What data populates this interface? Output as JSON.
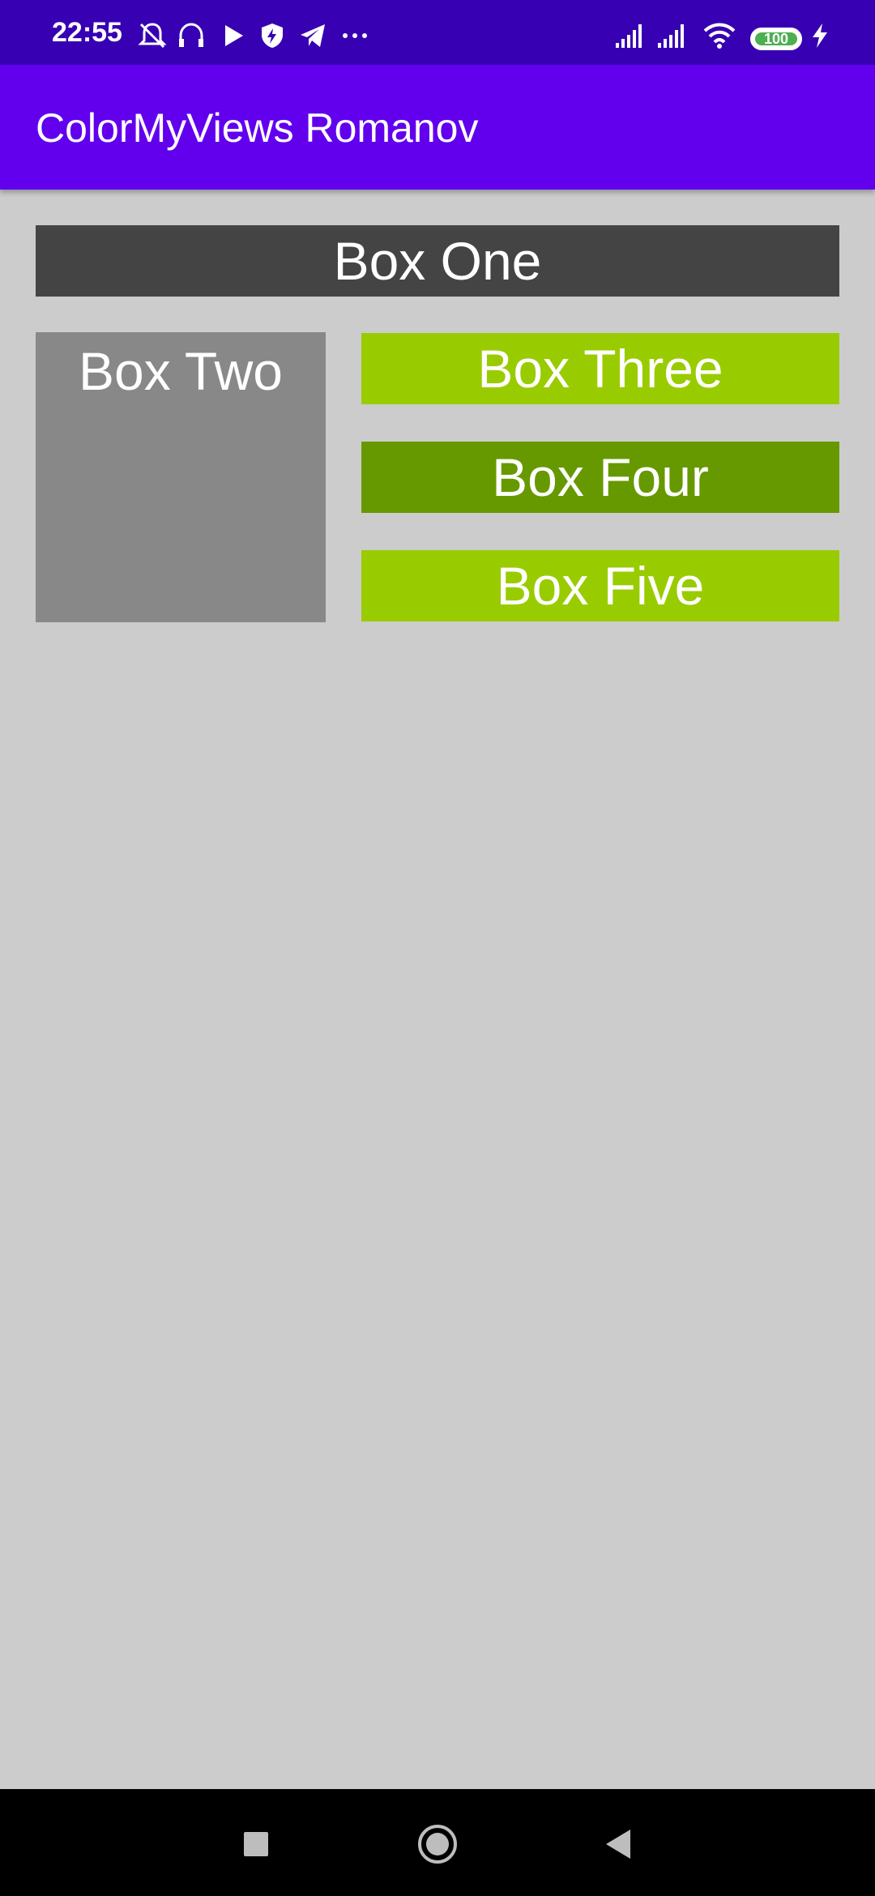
{
  "status_bar": {
    "time": "22:55",
    "battery_level": "100",
    "icons": [
      "bell-off-icon",
      "headphones-icon",
      "play-icon",
      "shield-icon",
      "telegram-icon",
      "more-icon",
      "signal-icon",
      "signal-icon",
      "wifi-icon",
      "battery-icon",
      "charging-icon"
    ]
  },
  "app_bar": {
    "title": "ColorMyViews Romanov"
  },
  "boxes": {
    "one": "Box One",
    "two": "Box Two",
    "three": "Box Three",
    "four": "Box Four",
    "five": "Box Five"
  },
  "colors": {
    "status_bar": "#3700b3",
    "app_bar": "#6200ee",
    "background": "#cccccc",
    "box_one": "#444444",
    "box_two": "#888888",
    "box_three": "#99cc00",
    "box_four": "#669900",
    "box_five": "#99cc00"
  },
  "nav_bar": {
    "buttons": [
      "recents-icon",
      "home-icon",
      "back-icon"
    ]
  }
}
